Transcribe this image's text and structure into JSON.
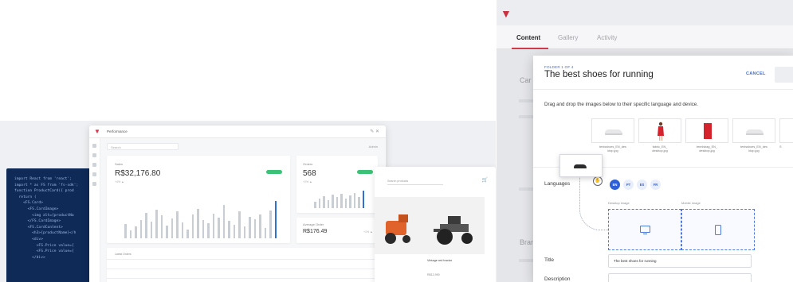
{
  "code_lines": [
    "import React from 'react';",
    "import * as FS from 'fs-sdk';",
    "",
    "function ProductCard({ prod",
    "  return (",
    "    <FS.Card>",
    "      <FS.CardImage>",
    "        <img alt={productNa",
    "      </FS.CardImage>",
    "      <FS.CardContent>",
    "        <h3>{productName}</h",
    "        <div>",
    "          <FS.Price value={",
    "          <FS.Price value={",
    "        </div>"
  ],
  "dashboard": {
    "title": "Performance",
    "search_placeholder": "Search",
    "user_label": "Admin",
    "revenue": {
      "label": "Sales",
      "value": "R$32,176.80",
      "sub": "+4% ▲"
    },
    "orders": {
      "label": "Orders",
      "value": "568",
      "sub": "+2% ▲"
    },
    "avg": {
      "label": "Average Order",
      "value": "R$176.49",
      "sub": "+1% ▲"
    },
    "table_header": "Latest Orders",
    "bar_heights": [
      35,
      20,
      28,
      45,
      62,
      40,
      70,
      55,
      30,
      48,
      66,
      38,
      22,
      58,
      72,
      44,
      36,
      60,
      50,
      80,
      42,
      33,
      65,
      28,
      52,
      47,
      57,
      25,
      68,
      90
    ],
    "orders_bars": [
      30,
      45,
      58,
      40,
      65,
      52,
      70,
      48,
      60,
      75,
      55,
      85
    ]
  },
  "shop": {
    "search_placeholder": "Search products",
    "products": [
      {
        "caption": "",
        "price": ""
      },
      {
        "caption": "Vintage red tractor",
        "price": "R$12,990"
      }
    ]
  },
  "app": {
    "tabs": [
      "Content",
      "Gallery",
      "Activity"
    ],
    "side_labels": [
      "Car",
      "Bran"
    ]
  },
  "modal": {
    "eyebrow": "FOLDER 1 OF 4",
    "title": "The best shoes for running",
    "cancel": "CANCEL",
    "instruction": "Drag and drop the images below to their specific language and device.",
    "images": [
      {
        "caption": "tenisshoes_EN_des\nktop.jpg"
      },
      {
        "caption": "fabric_EN_\ndesktop.jpg"
      },
      {
        "caption": "tennisbag_EN_\ndesktop.jpg"
      },
      {
        "caption": "tenisshoes_EN_des\nktop.jpg"
      },
      {
        "caption": "S"
      }
    ],
    "languages_label": "Languages",
    "languages": [
      "EN",
      "PT",
      "ES",
      "FR"
    ],
    "desktop_label": "Desktop image",
    "mobile_label": "Mobile image",
    "title_label": "Title",
    "title_value": "The best shoes for running",
    "description_label": "Description"
  },
  "colors": {
    "brand": "#d23a4c",
    "primary_blue": "#2f5fd6",
    "code_bg": "#0f2a57",
    "success": "#3cc276"
  }
}
